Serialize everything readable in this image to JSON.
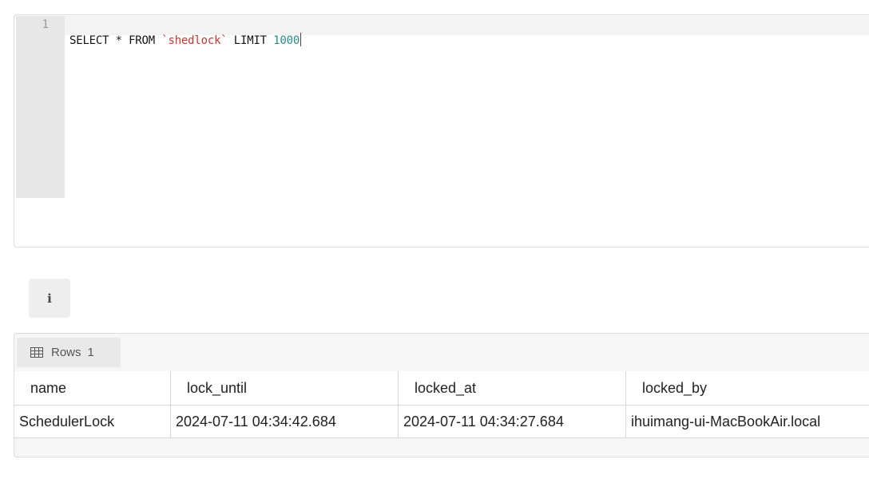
{
  "editor": {
    "line_number": "1",
    "tokens": {
      "select": "SELECT",
      "star": "*",
      "from": "FROM",
      "table": "`shedlock`",
      "limit": "LIMIT",
      "limit_value": "1000"
    }
  },
  "info_button": {
    "label": "i"
  },
  "results": {
    "rows_label": "Rows",
    "rows_count": "1",
    "columns": [
      "name",
      "lock_until",
      "locked_at",
      "locked_by"
    ],
    "rows": [
      [
        "SchedulerLock",
        "2024-07-11 04:34:42.684",
        "2024-07-11 04:34:27.684",
        "ihuimang-ui-MacBookAir.local"
      ]
    ]
  },
  "colors": {
    "string": "#c0392b",
    "number": "#2a8a8a",
    "gutter": "#e7e7e7"
  },
  "icons": {
    "rows": "table-grid-icon",
    "info": "info-icon"
  }
}
